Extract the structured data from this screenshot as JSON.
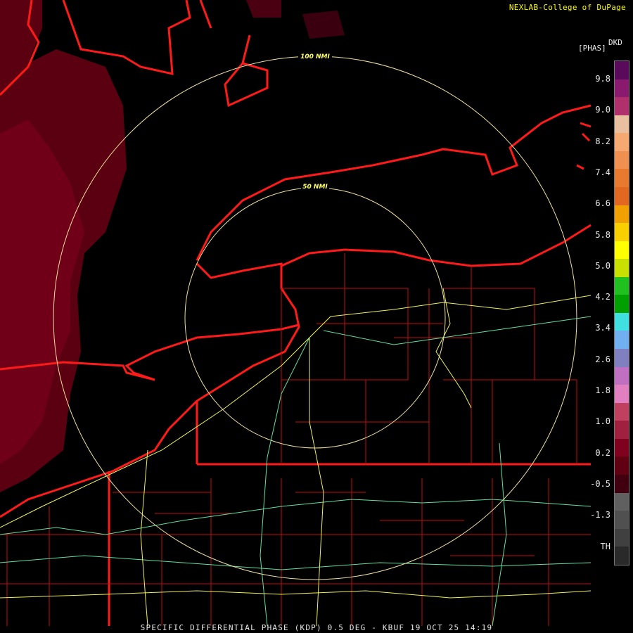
{
  "credit": "NEXLAB-College of DuPage",
  "product_code": "DKD",
  "units": "[PHAS]",
  "range_rings": [
    {
      "label": "100 NMI"
    },
    {
      "label": "50 NMI"
    }
  ],
  "legend": {
    "ticks": [
      "9.8",
      "9.0",
      "8.2",
      "7.4",
      "6.6",
      "5.8",
      "5.0",
      "4.2",
      "3.4",
      "2.6",
      "1.8",
      "1.0",
      "0.2",
      "-0.5",
      "-1.3",
      "TH"
    ],
    "colors": [
      "#5a0a5a",
      "#8a1a6e",
      "#b0306e",
      "#e8c0a0",
      "#f5a870",
      "#f09050",
      "#e87a30",
      "#e06820",
      "#f0a000",
      "#f8d000",
      "#ffff00",
      "#c8e000",
      "#20c020",
      "#00a000",
      "#40e0e0",
      "#70b0f0",
      "#8080c0",
      "#c070c0",
      "#e080c0",
      "#c04060",
      "#a02040",
      "#800020",
      "#600010",
      "#400010",
      "#606060",
      "#505050",
      "#404040",
      "#2a2a2a"
    ]
  },
  "footer": "SPECIFIC DIFFERENTIAL PHASE (KDP) 0.5 DEG - KBUF 19 OCT 25 14:19"
}
